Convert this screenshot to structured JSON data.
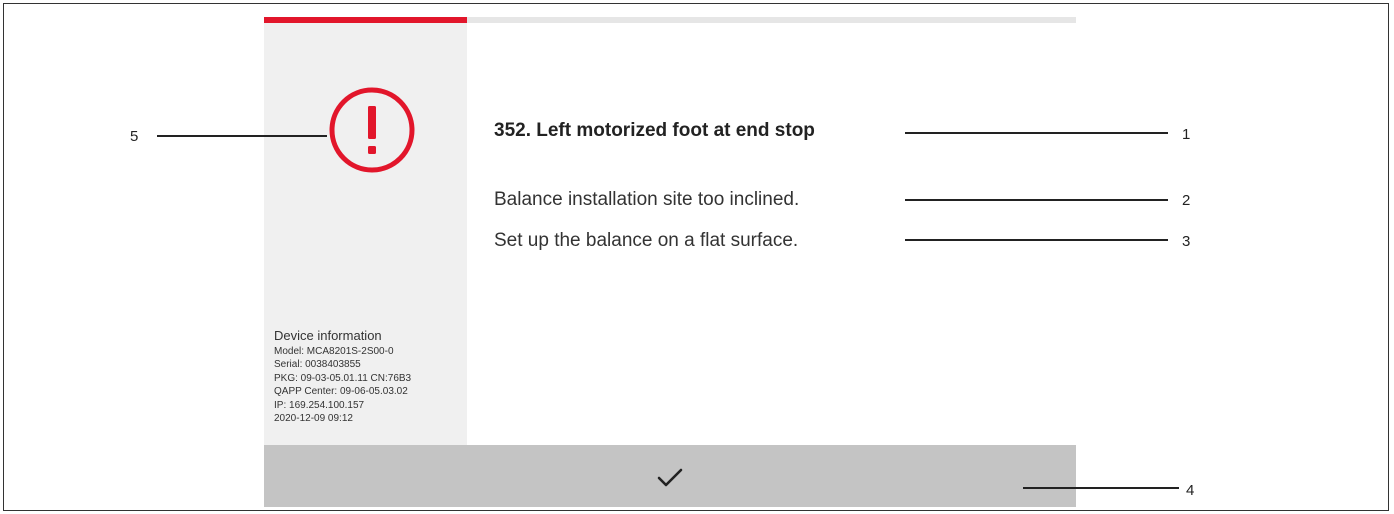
{
  "progress": {
    "fraction": 0.25,
    "color": "#e2162b"
  },
  "icons": {
    "status": "exclamation-circle-icon",
    "confirm": "checkmark-icon"
  },
  "colors": {
    "accent": "#e2162b",
    "side_panel": "#f0f0f0",
    "action_bar": "#c4c4c4"
  },
  "message": {
    "title": "352. Left motorized foot at end stop",
    "lines": [
      "Balance installation site too inclined.",
      "Set up the balance on a flat surface."
    ]
  },
  "device_info": {
    "heading": "Device information",
    "lines": [
      "Model: MCA8201S-2S00-0",
      "Serial: 0038403855",
      "PKG: 09-03-05.01.11 CN:76B3",
      "QAPP Center: 09-06-05.03.02",
      "IP: 169.254.100.157",
      "2020-12-09 09:12"
    ]
  },
  "callouts": [
    "1",
    "2",
    "3",
    "4",
    "5"
  ]
}
